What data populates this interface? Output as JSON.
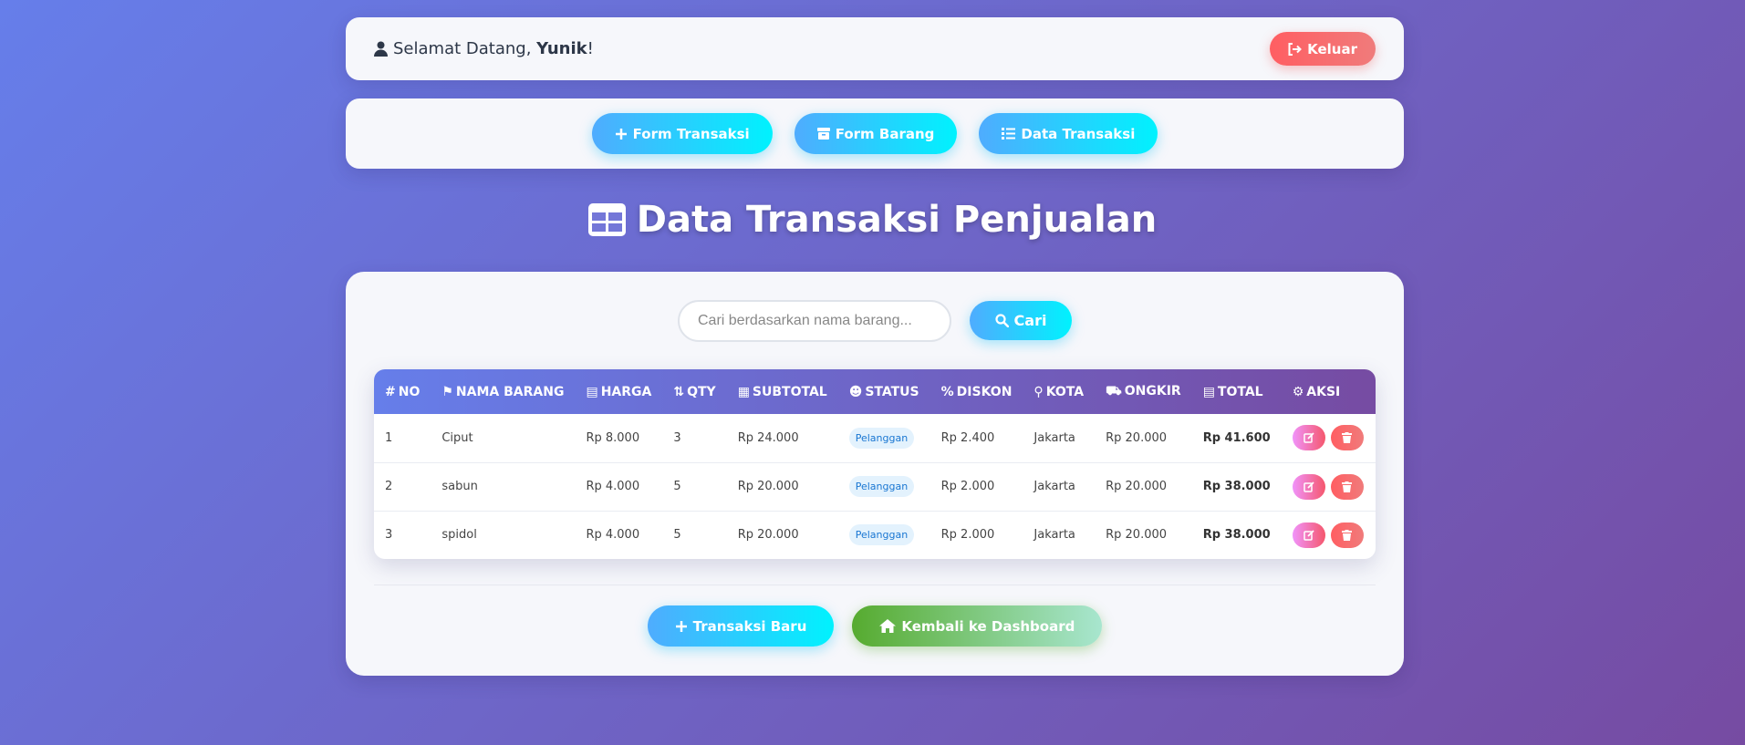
{
  "header": {
    "greeting": "Selamat Datang, ",
    "username": "Yunik",
    "exclaim": "!",
    "logout_label": "Keluar"
  },
  "nav": {
    "items": [
      {
        "label": "Form Transaksi",
        "icon": "plus-icon"
      },
      {
        "label": "Form Barang",
        "icon": "box-icon"
      },
      {
        "label": "Data Transaksi",
        "icon": "list-icon"
      }
    ]
  },
  "page": {
    "title": "Data Transaksi Penjualan",
    "title_icon": "table-icon"
  },
  "search": {
    "placeholder": "Cari berdasarkan nama barang...",
    "value": "",
    "button_label": "Cari"
  },
  "table": {
    "columns": [
      {
        "label": "NO",
        "icon": "hash-icon"
      },
      {
        "label": "NAMA BARANG",
        "icon": "tag-icon"
      },
      {
        "label": "HARGA",
        "icon": "money-icon"
      },
      {
        "label": "QTY",
        "icon": "sort-icon"
      },
      {
        "label": "SUBTOTAL",
        "icon": "calculator-icon"
      },
      {
        "label": "STATUS",
        "icon": "user-tag-icon"
      },
      {
        "label": "DISKON",
        "icon": "percent-icon"
      },
      {
        "label": "KOTA",
        "icon": "map-pin-icon"
      },
      {
        "label": "ONGKIR",
        "icon": "truck-icon"
      },
      {
        "label": "TOTAL",
        "icon": "receipt-icon"
      },
      {
        "label": "AKSI",
        "icon": "cogs-icon"
      }
    ],
    "rows": [
      {
        "no": "1",
        "nama": "Ciput",
        "harga": "Rp 8.000",
        "qty": "3",
        "subtotal": "Rp 24.000",
        "status": "Pelanggan",
        "diskon": "Rp 2.400",
        "kota": "Jakarta",
        "ongkir": "Rp 20.000",
        "total": "Rp 41.600"
      },
      {
        "no": "2",
        "nama": "sabun",
        "harga": "Rp 4.000",
        "qty": "5",
        "subtotal": "Rp 20.000",
        "status": "Pelanggan",
        "diskon": "Rp 2.000",
        "kota": "Jakarta",
        "ongkir": "Rp 20.000",
        "total": "Rp 38.000"
      },
      {
        "no": "3",
        "nama": "spidol",
        "harga": "Rp 4.000",
        "qty": "5",
        "subtotal": "Rp 20.000",
        "status": "Pelanggan",
        "diskon": "Rp 2.000",
        "kota": "Jakarta",
        "ongkir": "Rp 20.000",
        "total": "Rp 38.000"
      }
    ]
  },
  "footer": {
    "new_label": "Transaksi Baru",
    "back_label": "Kembali ke Dashboard"
  },
  "colors": {
    "bg_start": "#667eea",
    "bg_end": "#764ba2",
    "accent_cyan": "#00f2fe",
    "danger": "#ff5e62",
    "success": "#56ab2f"
  }
}
